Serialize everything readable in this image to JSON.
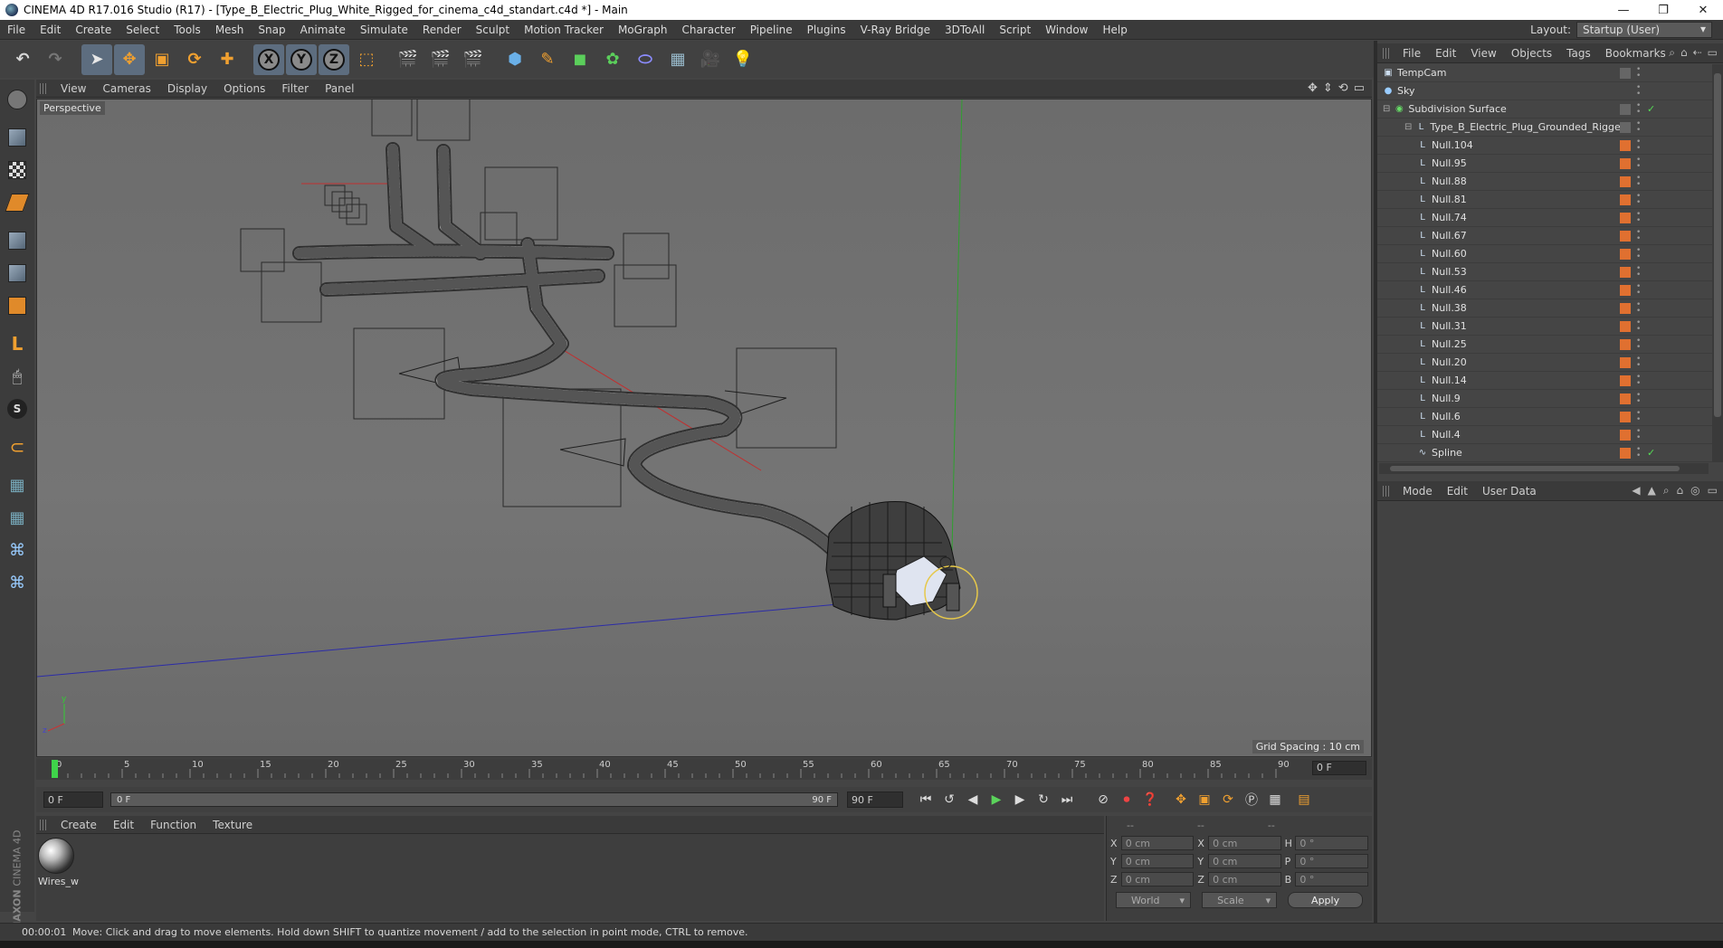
{
  "window": {
    "title": "CINEMA 4D R17.016 Studio (R17) - [Type_B_Electric_Plug_White_Rigged_for_cinema_c4d_standart.c4d *] - Main",
    "controls": [
      "—",
      "❐",
      "✕"
    ]
  },
  "menu": {
    "items": [
      "File",
      "Edit",
      "Create",
      "Select",
      "Tools",
      "Mesh",
      "Snap",
      "Animate",
      "Simulate",
      "Render",
      "Sculpt",
      "Motion Tracker",
      "MoGraph",
      "Character",
      "Pipeline",
      "Plugins",
      "V-Ray Bridge",
      "3DToAll",
      "Script",
      "Window",
      "Help"
    ],
    "layout_label": "Layout:",
    "layout_value": "Startup (User)"
  },
  "toolbar": {
    "axis_x": "X",
    "axis_y": "Y",
    "axis_z": "Z"
  },
  "viewport": {
    "menu": [
      "View",
      "Cameras",
      "Display",
      "Options",
      "Filter",
      "Panel"
    ],
    "view_name": "Perspective",
    "grid_spacing": "Grid Spacing : 10 cm",
    "axis_y": "y",
    "axis_x": "x",
    "axis_z": "z",
    "colors": {
      "x_axis": "#c03030",
      "y_axis": "#2fa02f",
      "z_axis": "#2c2ca8",
      "selection": "#e6c84a"
    }
  },
  "timeline": {
    "ticks": [
      "0",
      "5",
      "10",
      "15",
      "20",
      "25",
      "30",
      "35",
      "40",
      "45",
      "50",
      "55",
      "60",
      "65",
      "70",
      "75",
      "80",
      "85",
      "90"
    ],
    "current_frame": "0 F",
    "start_field": "0 F",
    "range_start": "0 F",
    "range_end": "90 F",
    "end_field": "90 F"
  },
  "materials": {
    "menu": [
      "Create",
      "Edit",
      "Function",
      "Texture"
    ],
    "items": [
      {
        "name": "Wires_w"
      }
    ]
  },
  "coordinates": {
    "heads": [
      "--",
      "--",
      "--"
    ],
    "rows": [
      {
        "l1": "X",
        "v1": "0 cm",
        "l2": "X",
        "v2": "0 cm",
        "l3": "H",
        "v3": "0 °"
      },
      {
        "l1": "Y",
        "v1": "0 cm",
        "l2": "Y",
        "v2": "0 cm",
        "l3": "P",
        "v3": "0 °"
      },
      {
        "l1": "Z",
        "v1": "0 cm",
        "l2": "Z",
        "v2": "0 cm",
        "l3": "B",
        "v3": "0 °"
      }
    ],
    "space": "World",
    "mode": "Scale",
    "apply": "Apply"
  },
  "status": {
    "time": "00:00:01",
    "message": "Move: Click and drag to move elements. Hold down SHIFT to quantize movement / add to the selection in point mode, CTRL to remove."
  },
  "object_manager": {
    "menu": [
      "File",
      "Edit",
      "View",
      "Objects",
      "Tags",
      "Bookmarks"
    ],
    "objects": [
      {
        "name": "TempCam",
        "indent": 0,
        "icon": "camera",
        "tag": "grey"
      },
      {
        "name": "Sky",
        "indent": 0,
        "icon": "sky",
        "tag": "none"
      },
      {
        "name": "Subdivision Surface",
        "indent": 0,
        "icon": "subdiv",
        "tag": "check"
      },
      {
        "name": "Type_B_Electric_Plug_Grounded_Rigged",
        "indent": 1,
        "icon": "null",
        "tag": "grey"
      },
      {
        "name": "Null.104",
        "indent": 2,
        "icon": "null",
        "tag": "orange"
      },
      {
        "name": "Null.95",
        "indent": 2,
        "icon": "null",
        "tag": "orange"
      },
      {
        "name": "Null.88",
        "indent": 2,
        "icon": "null",
        "tag": "orange"
      },
      {
        "name": "Null.81",
        "indent": 2,
        "icon": "null",
        "tag": "orange"
      },
      {
        "name": "Null.74",
        "indent": 2,
        "icon": "null",
        "tag": "orange"
      },
      {
        "name": "Null.67",
        "indent": 2,
        "icon": "null",
        "tag": "orange"
      },
      {
        "name": "Null.60",
        "indent": 2,
        "icon": "null",
        "tag": "orange"
      },
      {
        "name": "Null.53",
        "indent": 2,
        "icon": "null",
        "tag": "orange"
      },
      {
        "name": "Null.46",
        "indent": 2,
        "icon": "null",
        "tag": "orange"
      },
      {
        "name": "Null.38",
        "indent": 2,
        "icon": "null",
        "tag": "orange"
      },
      {
        "name": "Null.31",
        "indent": 2,
        "icon": "null",
        "tag": "orange"
      },
      {
        "name": "Null.25",
        "indent": 2,
        "icon": "null",
        "tag": "orange"
      },
      {
        "name": "Null.20",
        "indent": 2,
        "icon": "null",
        "tag": "orange"
      },
      {
        "name": "Null.14",
        "indent": 2,
        "icon": "null",
        "tag": "orange"
      },
      {
        "name": "Null.9",
        "indent": 2,
        "icon": "null",
        "tag": "orange"
      },
      {
        "name": "Null.6",
        "indent": 2,
        "icon": "null",
        "tag": "orange"
      },
      {
        "name": "Null.4",
        "indent": 2,
        "icon": "null",
        "tag": "orange"
      },
      {
        "name": "Spline",
        "indent": 2,
        "icon": "spline",
        "tag": "orange"
      }
    ]
  },
  "attributes": {
    "menu": [
      "Mode",
      "Edit",
      "User Data"
    ]
  },
  "brand": {
    "maxon": "MAXON",
    "c4d": "CINEMA 4D"
  }
}
